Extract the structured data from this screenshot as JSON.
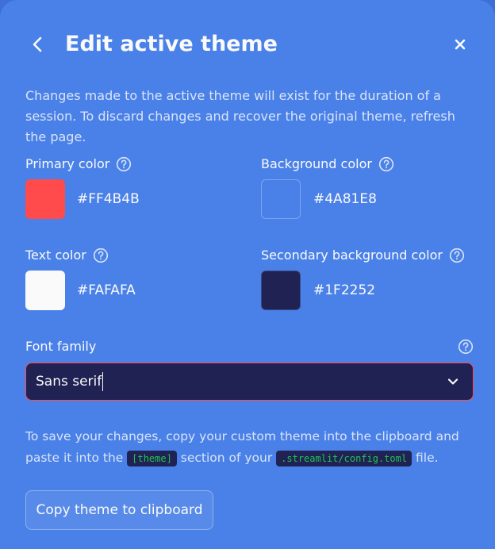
{
  "header": {
    "title": "Edit active theme"
  },
  "description": "Changes made to the active theme will exist for the duration of a session. To discard changes and recover the original theme, refresh the page.",
  "colors": {
    "primary": {
      "label": "Primary color",
      "hex": "#FF4B4B"
    },
    "background": {
      "label": "Background color",
      "hex": "#4A81E8"
    },
    "text": {
      "label": "Text color",
      "hex": "#FAFAFA"
    },
    "secondary_background": {
      "label": "Secondary background color",
      "hex": "#1F2252"
    }
  },
  "font_family": {
    "label": "Font family",
    "value": "Sans serif"
  },
  "instructions": {
    "part1": "To save your changes, copy your custom theme into the clipboard and paste it into the ",
    "code1": "[theme]",
    "part2": " section of your ",
    "code2": ".streamlit/config.toml",
    "part3": " file."
  },
  "copy_button": {
    "label": "Copy theme to clipboard"
  },
  "icons": {
    "back": "chevron-left-icon",
    "close": "close-icon",
    "help": "question-circle-icon",
    "dropdown": "chevron-down-icon"
  }
}
